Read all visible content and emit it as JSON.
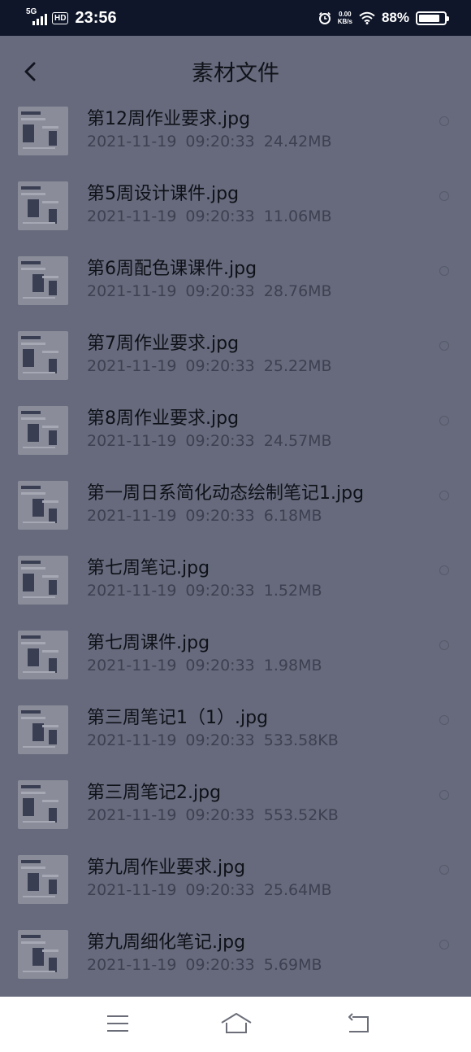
{
  "status_bar": {
    "network": "5G",
    "hd_badge": "HD",
    "time": "23:56",
    "speed_value": "0.00",
    "speed_unit": "KB/s",
    "battery_percent": "88%",
    "battery_level": 0.88
  },
  "header": {
    "title": "素材文件"
  },
  "files": [
    {
      "name": "第12周作业要求.jpg",
      "date": "2021-11-19",
      "time": "09:20:33",
      "size": "24.42MB"
    },
    {
      "name": "第5周设计课件.jpg",
      "date": "2021-11-19",
      "time": "09:20:33",
      "size": "11.06MB"
    },
    {
      "name": "第6周配色课课件.jpg",
      "date": "2021-11-19",
      "time": "09:20:33",
      "size": "28.76MB"
    },
    {
      "name": "第7周作业要求.jpg",
      "date": "2021-11-19",
      "time": "09:20:33",
      "size": "25.22MB"
    },
    {
      "name": "第8周作业要求.jpg",
      "date": "2021-11-19",
      "time": "09:20:33",
      "size": "24.57MB"
    },
    {
      "name": "第一周日系简化动态绘制笔记1.jpg",
      "date": "2021-11-19",
      "time": "09:20:33",
      "size": "6.18MB"
    },
    {
      "name": "第七周笔记.jpg",
      "date": "2021-11-19",
      "time": "09:20:33",
      "size": "1.52MB"
    },
    {
      "name": "第七周课件.jpg",
      "date": "2021-11-19",
      "time": "09:20:33",
      "size": "1.98MB"
    },
    {
      "name": "第三周笔记1（1）.jpg",
      "date": "2021-11-19",
      "time": "09:20:33",
      "size": "533.58KB"
    },
    {
      "name": "第三周笔记2.jpg",
      "date": "2021-11-19",
      "time": "09:20:33",
      "size": "553.52KB"
    },
    {
      "name": "第九周作业要求.jpg",
      "date": "2021-11-19",
      "time": "09:20:33",
      "size": "25.64MB"
    },
    {
      "name": "第九周细化笔记.jpg",
      "date": "2021-11-19",
      "time": "09:20:33",
      "size": "5.69MB"
    }
  ],
  "icons": {
    "back": "chevron-left-icon",
    "menu": "menu-icon",
    "home": "home-icon",
    "return": "return-icon"
  }
}
